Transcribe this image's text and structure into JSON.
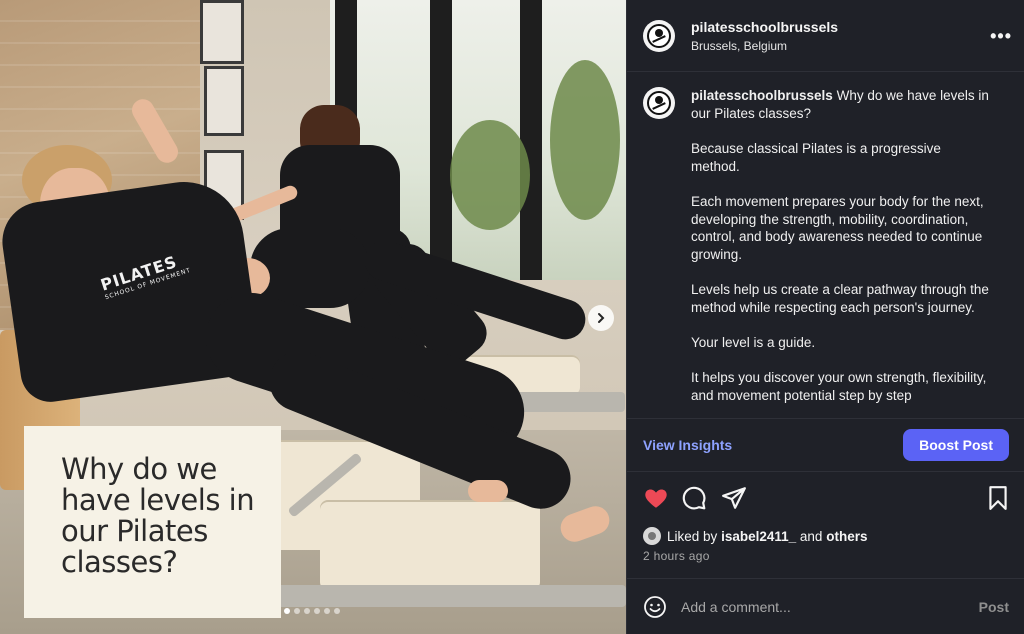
{
  "post": {
    "username": "pilatesschoolbrussels",
    "location": "Brussels, Belgium",
    "image_caption": "Why do we have levels in our Pilates classes?",
    "shirt_logo": "PILATES",
    "shirt_logo_sub": "SCHOOL OF MOVEMENT",
    "slide_count": 6,
    "active_slide": 1
  },
  "caption": {
    "username": "pilatesschoolbrussels",
    "headline": "Why do we have levels in our Pilates classes?",
    "paragraphs": [
      "Because classical Pilates is a progressive method.",
      "Each movement prepares your body for the next, developing the strength, mobility, coordination, control, and body awareness needed to continue growing.",
      "Levels help us create a clear pathway through the method while respecting each person's journey.",
      "Your level is a guide.",
      "It helps you discover your own strength, flexibility, and movement potential step by step"
    ]
  },
  "insights": {
    "view_label": "View Insights",
    "boost_label": "Boost Post"
  },
  "likes": {
    "prefix": "Liked by",
    "user": "isabel2411_",
    "joiner": "and",
    "others": "others"
  },
  "time_ago": "2 hours ago",
  "comment": {
    "placeholder": "Add a comment...",
    "post_label": "Post"
  },
  "icons": {
    "like": "heart-icon",
    "comment": "comment-icon",
    "share": "share-icon",
    "save": "bookmark-icon",
    "more": "more-icon",
    "emoji": "emoji-icon",
    "next": "chevron-right-icon"
  },
  "colors": {
    "panel_bg": "#1f2128",
    "accent": "#5b63f5",
    "link": "#8ea2ff",
    "heart": "#ed4956",
    "caption_card": "#f6f2e6"
  }
}
